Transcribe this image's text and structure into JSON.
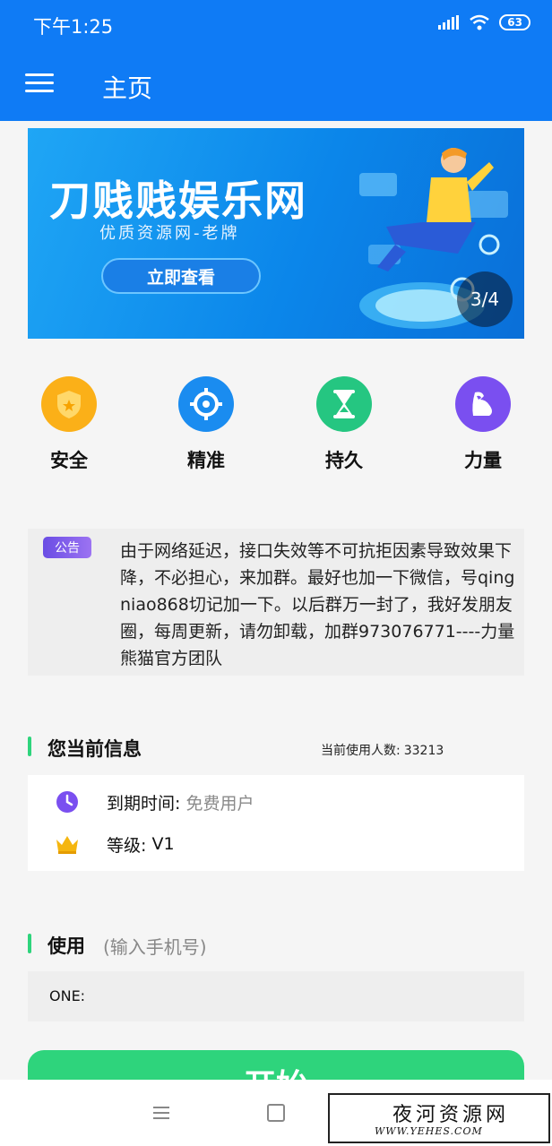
{
  "status_bar": {
    "time": "下午1:25",
    "battery": "63"
  },
  "header": {
    "title": "主页"
  },
  "banner": {
    "title": "刀贱贱娱乐网",
    "subtitle": "优质资源网-老牌",
    "button": "立即查看",
    "page_indicator": "3/4"
  },
  "features": [
    {
      "label": "安全",
      "icon": "shield-icon",
      "color": "#fbb018"
    },
    {
      "label": "精准",
      "icon": "target-icon",
      "color": "#1a8cf0"
    },
    {
      "label": "持久",
      "icon": "hourglass-icon",
      "color": "#25c681"
    },
    {
      "label": "力量",
      "icon": "muscle-icon",
      "color": "#7a4ff0"
    }
  ],
  "notice": {
    "tag": "公告",
    "text": "由于网络延迟，接口失效等不可抗拒因素导致效果下降，不必担心，来加群。最好也加一下微信，号qingniao868切记加一下。以后群万一封了，我好发朋友圈，每周更新，请勿卸载，加群973076771----力量熊猫官方团队"
  },
  "info": {
    "title": "您当前信息",
    "users_label": "当前使用人数:",
    "users_count": "33213",
    "expiry_label": "到期时间:",
    "expiry_value": "免费用户",
    "level_label": "等级:",
    "level_value": "V1"
  },
  "use": {
    "title": "使用",
    "hint": "(输入手机号)",
    "field_label": "ONE:",
    "field_value": "",
    "button": "开始"
  },
  "watermark": {
    "line1": "夜河资源网",
    "line2": "WWW.YEHES.COM"
  },
  "colors": {
    "primary": "#0f7bf5",
    "accent": "#2ed47c"
  }
}
